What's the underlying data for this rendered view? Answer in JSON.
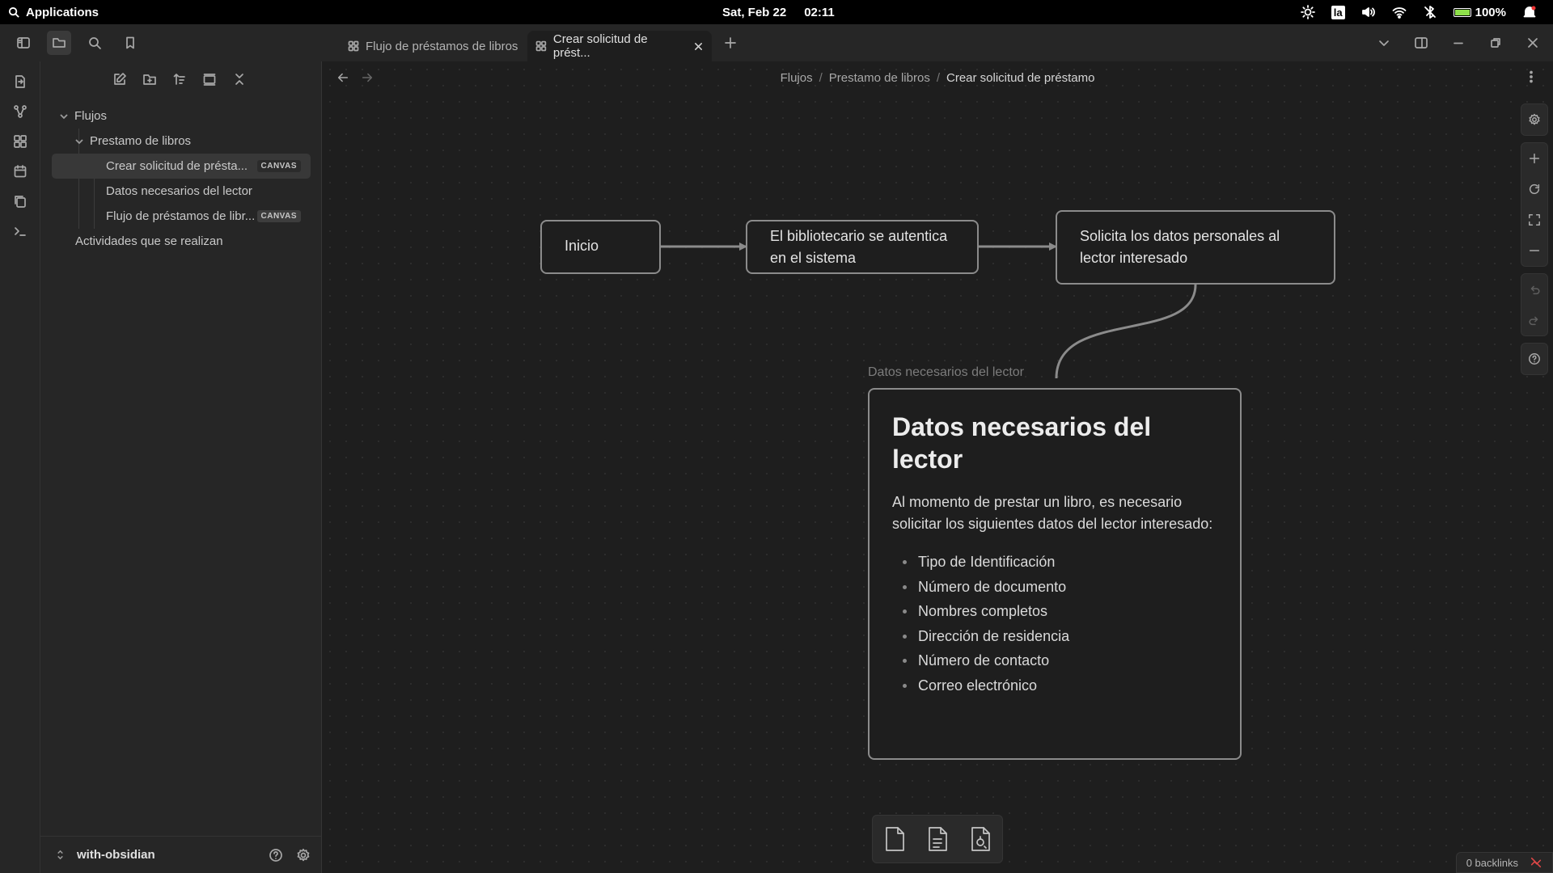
{
  "system_bar": {
    "apps_label": "Applications",
    "date": "Sat, Feb 22",
    "time": "02:11",
    "language": "la",
    "battery": "100%"
  },
  "tabs": [
    {
      "label": "Flujo de préstamos de libros",
      "active": false
    },
    {
      "label": "Crear solicitud de prést...",
      "active": true
    }
  ],
  "sidebar": {
    "tree": [
      {
        "label": "Flujos",
        "level": 0,
        "expanded": true
      },
      {
        "label": "Prestamo de libros",
        "level": 1,
        "expanded": true
      },
      {
        "label": "Crear solicitud de présta...",
        "level": 2,
        "badge": "CANVAS",
        "selected": true
      },
      {
        "label": "Datos necesarios del lector",
        "level": 2
      },
      {
        "label": "Flujo de préstamos de libr...",
        "level": 2,
        "badge": "CANVAS"
      },
      {
        "label": "Actividades que se realizan",
        "level": 0
      }
    ],
    "vault_name": "with-obsidian"
  },
  "breadcrumb": {
    "items": [
      "Flujos",
      "Prestamo de libros",
      "Crear solicitud de préstamo"
    ],
    "separator": "/"
  },
  "canvas": {
    "nodes": {
      "inicio": "Inicio",
      "auth": "El bibliotecario se autentica en el sistema",
      "request": "Solicita los datos personales al lector interesado"
    },
    "group_label": "Datos necesarios del lector",
    "doc": {
      "title": "Datos necesarios del lector",
      "paragraph": "Al momento de prestar un libro, es necesario solicitar los siguientes datos del lector interesado:",
      "items": [
        "Tipo de Identificación",
        "Número de documento",
        "Nombres completos",
        "Dirección de residencia",
        "Número de contacto",
        "Correo electrónico"
      ]
    }
  },
  "status": {
    "backlinks": "0 backlinks"
  },
  "colors": {
    "background": "#1e1e1e",
    "panel": "#262626",
    "node_border": "#8b8b8b",
    "edge": "#8b8b8b"
  }
}
